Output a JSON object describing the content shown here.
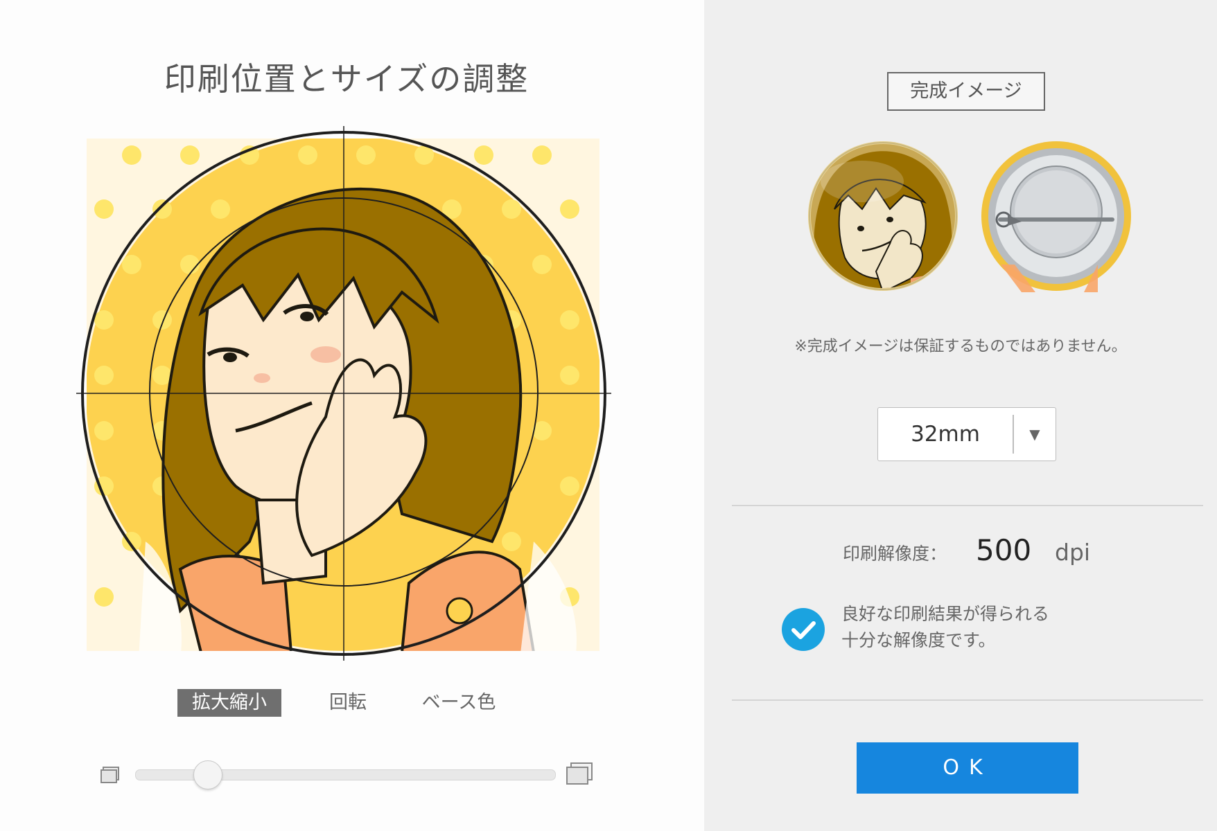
{
  "editor": {
    "title": "印刷位置とサイズの調整",
    "tabs": [
      {
        "label": "拡大縮小",
        "active": true
      },
      {
        "label": "回転",
        "active": false
      },
      {
        "label": "ベース色",
        "active": false
      }
    ],
    "zoom_slider": {
      "value_fraction": 0.13
    },
    "colors": {
      "badge_bg": "#fdd24f",
      "dot": "#fee66b",
      "hair": "#9a7000",
      "skin": "#fde9cc",
      "shirt": "#f9a56a"
    }
  },
  "preview": {
    "label": "完成イメージ",
    "disclaimer": "※完成イメージは保証するものではありません。",
    "size_select": {
      "value": "32mm",
      "arrow": "▼"
    },
    "resolution": {
      "label": "印刷解像度：",
      "value": "500",
      "unit": "dpi"
    },
    "status_message_line1": "良好な印刷結果が得られる",
    "status_message_line2": "十分な解像度です。",
    "ok_label": "OK",
    "accent_color": "#1686de",
    "check_color": "#1ba3e0"
  }
}
